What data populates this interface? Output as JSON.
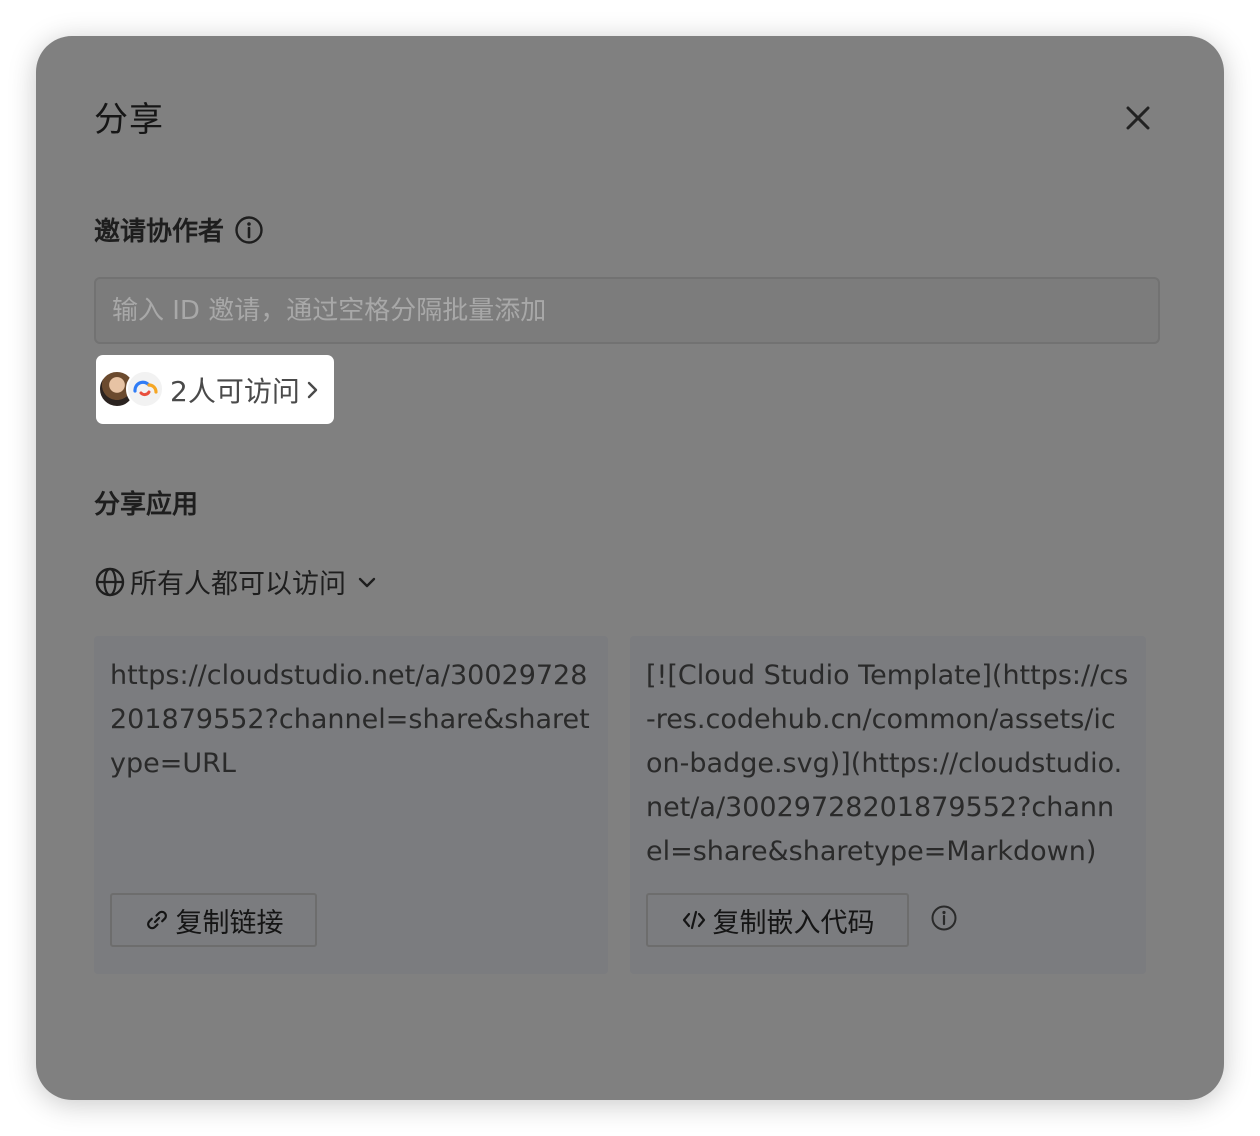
{
  "dialog": {
    "title": "分享",
    "close_icon": "close-icon"
  },
  "invite": {
    "label": "邀请协作者",
    "info_icon": "info-icon",
    "placeholder": "输入 ID 邀请，通过空格分隔批量添加",
    "access_count_label": "2人可访问"
  },
  "share_app": {
    "label": "分享应用",
    "visibility_label": "所有人都可以访问",
    "globe_icon": "globe-icon",
    "caret_icon": "chevron-down-icon",
    "url_card": {
      "text": "https://cloudstudio.net/a/30029728201879552?channel=share&sharetype=URL",
      "button_label": "复制链接",
      "button_icon": "link-icon"
    },
    "embed_card": {
      "text": "[![Cloud Studio Template](https://cs-res.codehub.cn/common/assets/icon-badge.svg)](https://cloudstudio.net/a/30029728201879552?channel=share&sharetype=Markdown)",
      "button_label": "复制嵌入代码",
      "button_icon": "code-icon",
      "info_icon": "info-icon"
    }
  },
  "colors": {
    "overlay": "#808080",
    "chip_bg": "#ffffff",
    "card_bg": "#7b7c7f",
    "text_dark": "#1e1e1e"
  }
}
